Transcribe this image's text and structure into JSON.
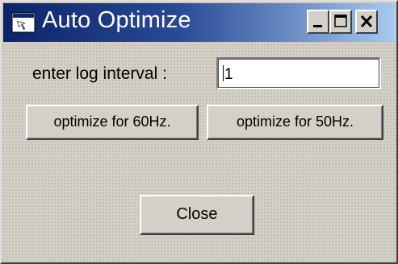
{
  "window": {
    "title": "Auto Optimize",
    "icon": "app-window-icon",
    "controls": {
      "minimize_icon": "minimize-icon",
      "maximize_icon": "maximize-icon",
      "close_icon": "close-icon"
    },
    "colors": {
      "titlebar_start": "#0a246a",
      "titlebar_end": "#a6caf0",
      "face": "#d4d0c8"
    }
  },
  "form": {
    "log_interval_label": "enter log interval :",
    "log_interval_value": "1"
  },
  "buttons": {
    "optimize_60": "optimize for 60Hz.",
    "optimize_50": "optimize for 50Hz.",
    "close": "Close"
  }
}
